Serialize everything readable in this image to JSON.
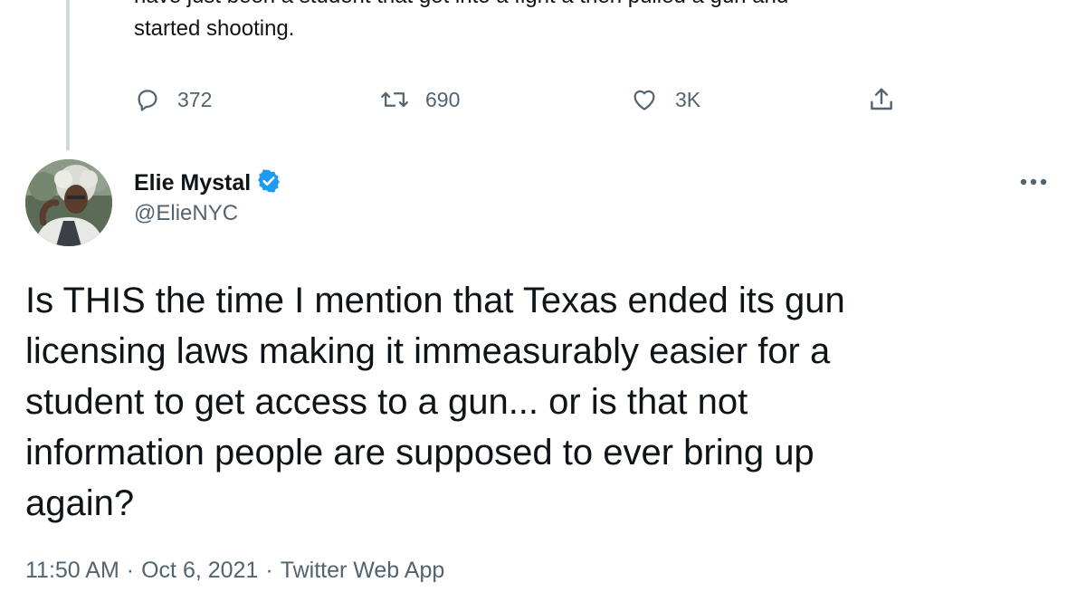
{
  "previous_tweet": {
    "text_line1": "have just been a student that got into a fight a then pulled a gun and",
    "text_line2": "started shooting.",
    "actions": {
      "reply_count": "372",
      "retweet_count": "690",
      "like_count": "3K"
    }
  },
  "tweet": {
    "author": {
      "display_name": "Elie Mystal",
      "handle": "@ElieNYC",
      "verified": true
    },
    "text": "Is THIS the time I mention that Texas ended its gun\nlicensing laws making it immeasurably easier for a\nstudent to get access to a gun... or is that not\ninformation people are supposed to ever bring up\nagain?",
    "time": "11:50 AM",
    "date": "Oct 6, 2021",
    "source": "Twitter Web App",
    "separator": "·"
  },
  "icons": {
    "reply": "reply-icon",
    "retweet": "retweet-icon",
    "like": "like-icon",
    "share": "share-icon",
    "verified": "verified-badge-icon",
    "more": "more-options-icon"
  },
  "colors": {
    "text_primary": "#0f1419",
    "text_secondary": "#536471",
    "verified_blue": "#1d9bf0",
    "thread_line": "#cfd9de"
  }
}
